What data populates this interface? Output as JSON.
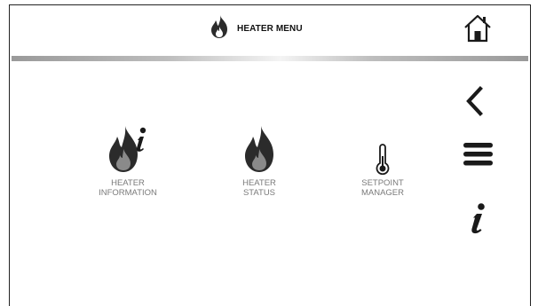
{
  "header": {
    "title": "HEATER MENU",
    "title_icon": "flame-icon",
    "home_icon": "home-icon"
  },
  "tiles": [
    {
      "icon": "flame-info-icon",
      "line1": "HEATER",
      "line2": "INFORMATION"
    },
    {
      "icon": "flame-icon",
      "line1": "HEATER",
      "line2": "STATUS"
    },
    {
      "icon": "thermometer-icon",
      "line1": "SETPOINT",
      "line2": "MANAGER"
    }
  ],
  "sidebar": {
    "back_icon": "chevron-left-icon",
    "menu_icon": "menu-icon",
    "info_icon": "info-icon"
  },
  "colors": {
    "label": "#7a7a7a",
    "icon_dark": "#2b2b2b",
    "icon_gray": "#8a8a8a",
    "divider": "#b0b0b0"
  }
}
